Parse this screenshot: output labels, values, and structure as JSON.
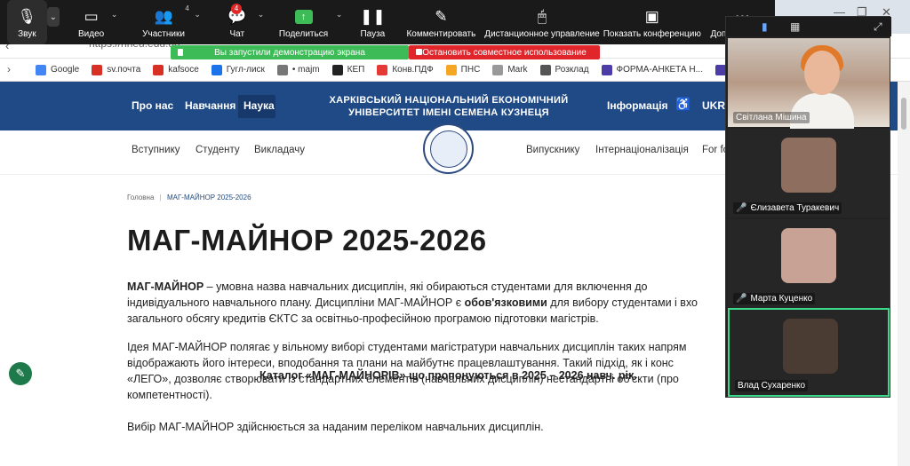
{
  "browser": {
    "url": "https://hneu.edu.ua",
    "bookmarks": [
      {
        "label": "Google",
        "color": "#4285f4"
      },
      {
        "label": "sv.почта",
        "color": "#d93025"
      },
      {
        "label": "kafsoce",
        "color": "#d93025"
      },
      {
        "label": "Гугл-лиск",
        "color": "#1a73e8"
      },
      {
        "label": "• majm",
        "color": "#777777"
      },
      {
        "label": "КЕП",
        "color": "#222222"
      },
      {
        "label": "Конв.ПДФ",
        "color": "#e53935"
      },
      {
        "label": "ПНС",
        "color": "#f5a623"
      },
      {
        "label": "Mark",
        "color": "#999999"
      },
      {
        "label": "Розклад",
        "color": "#555555"
      },
      {
        "label": "ФОРМА-АНКЕТА Н...",
        "color": "#4b3ca8"
      },
      {
        "label": "П",
        "color": "#4b3ca8"
      }
    ]
  },
  "zoom": {
    "toolbar": {
      "sound": "Звук",
      "video": "Видео",
      "participants": "Участники",
      "participants_count": "4",
      "chat": "Чат",
      "chat_badge": "4",
      "share": "Поделиться",
      "pause": "Пауза",
      "annotate": "Комментировать",
      "remote": "Дистанционное управление",
      "show": "Показать конференцию",
      "more": "Дополнительно"
    },
    "share_banner": "Вы запустили демонстрацию экрана",
    "stop_share": "Остановить совместное использование",
    "participants": [
      {
        "name": "Світлана Мішина",
        "muted": false,
        "type": "video"
      },
      {
        "name": "Єлизавета Туракевич",
        "muted": true,
        "type": "photo",
        "color": "#8e6e5e"
      },
      {
        "name": "Марта Куценко",
        "muted": true,
        "type": "photo",
        "color": "#c9a296"
      },
      {
        "name": "Влад Сухаренко",
        "muted": false,
        "type": "photo",
        "color": "#4a3b33",
        "active": true
      }
    ]
  },
  "site": {
    "topnav": {
      "about": "Про нас",
      "study": "Навчання",
      "science": "Наука",
      "info": "Інформація",
      "lang": "UKR"
    },
    "university": [
      "ХАРКІВСЬКИЙ НАЦІОНАЛЬНИЙ ЕКОНОМІЧНИЙ",
      "УНІВЕРСИТЕТ ІМЕНІ СЕМЕНА КУЗНЕЦЯ"
    ],
    "subnav": {
      "enter": "Вступнику",
      "student": "Студенту",
      "teacher": "Викладачу",
      "grad": "Випускнику",
      "intl": "Інтернаціоналізація",
      "for": "For fo"
    },
    "breadcrumb": {
      "home": "Головна",
      "current": "МАГ-МАЙНОР 2025-2026"
    },
    "title": "МАГ-МАЙНОР 2025-2026",
    "p1": {
      "l1_b": "МАГ-МАЙНОР",
      "l1": " – умовна назва навчальних дисциплін, які обираються студентами для включення до",
      "l2_a": "індивідуального навчального плану. Дисципліни МАГ-МАЙНОР є ",
      "l2_b": "обов'язковими",
      "l2_c": " для вибору студентами і вхо",
      "l3": "загального обсягу кредитів ЄКТС за освітньо-професійною програмою підготовки магістрів."
    },
    "p2": [
      "Ідея МАГ-МАЙНОР полягає у вільному виборі студентами магістратури навчальних дисциплін таких напрям",
      "відображають його інтереси, вподобання та плани на майбутнє працевлаштування. Такий підхід, як і конс",
      "«ЛЕГО», дозволяє створювати із стандартних елементів (навчальних дисциплін) нестандартні об'єкти (про",
      "компетентності)."
    ],
    "p3": "Вибір МАГ-МАЙНОР здійснюється за наданим переліком навчальних дисциплін.",
    "catalog": "Каталог «МАГ-МАЙНОРІВ» що пропонуються в 2025 – 2026 навч. рік."
  }
}
